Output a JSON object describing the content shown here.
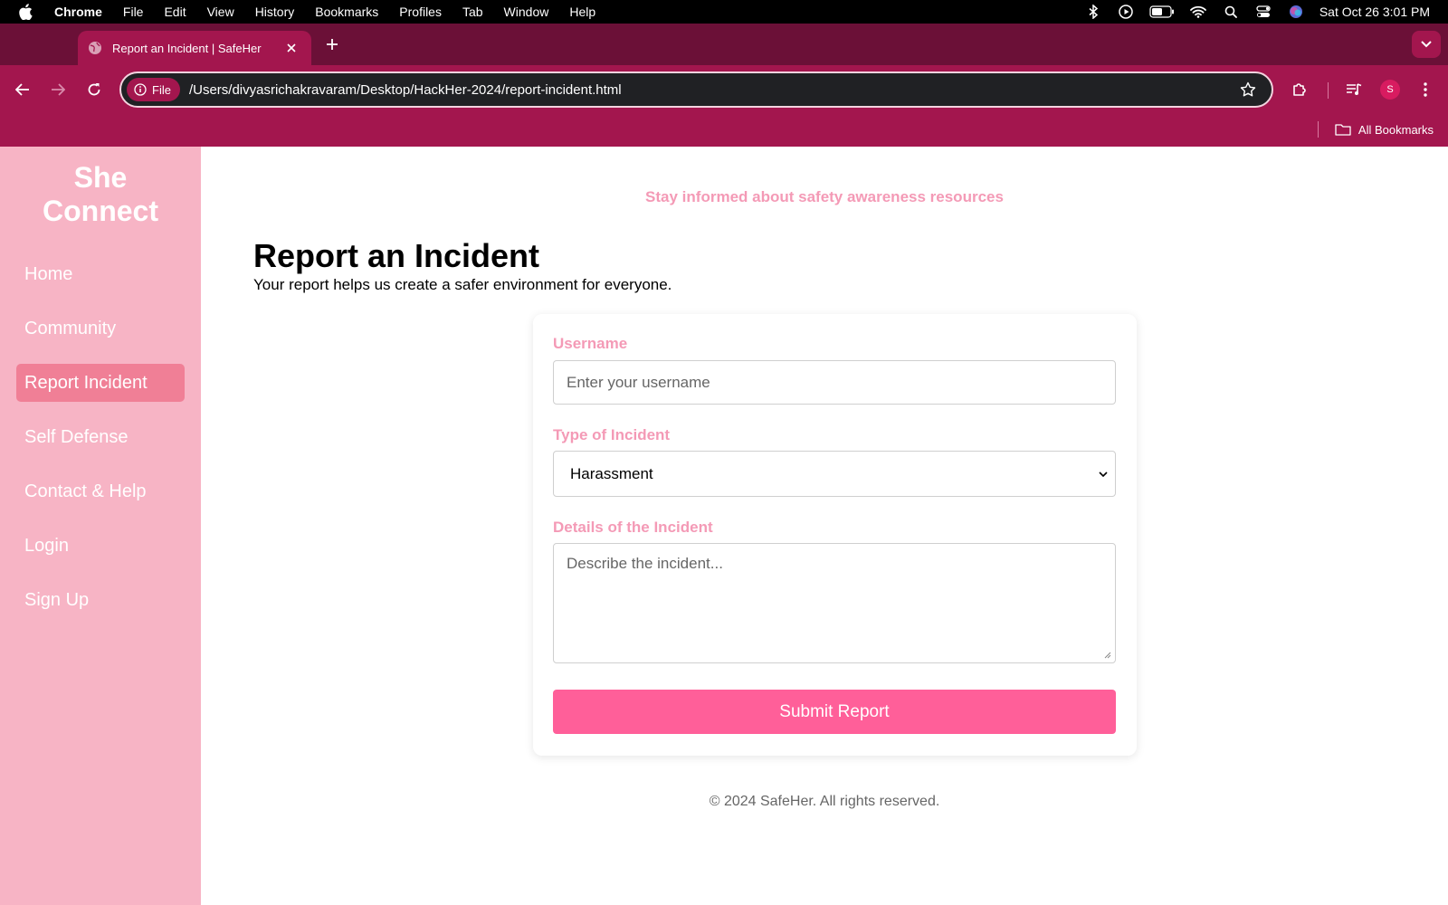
{
  "menubar": {
    "app_name": "Chrome",
    "items": [
      "File",
      "Edit",
      "View",
      "History",
      "Bookmarks",
      "Profiles",
      "Tab",
      "Window",
      "Help"
    ],
    "clock": "Sat Oct 26  3:01 PM",
    "status_icons": [
      "bluetooth-icon",
      "play-circle-icon",
      "battery-icon",
      "wifi-icon",
      "spotlight-search-icon",
      "control-center-icon",
      "siri-icon"
    ]
  },
  "browser": {
    "tab_title": "Report an Incident | SafeHer",
    "chip_label": "File",
    "url": "/Users/divyasrichakravaram/Desktop/HackHer-2024/report-incident.html",
    "profile_initial": "S",
    "bookmarks_label": "All Bookmarks",
    "colors": {
      "tabstrip": "#6b1037",
      "toolbar": "#a3164e"
    }
  },
  "sidebar": {
    "brand_line1": "She",
    "brand_line2": "Connect",
    "items": [
      {
        "label": "Home",
        "active": false
      },
      {
        "label": "Community",
        "active": false
      },
      {
        "label": "Report Incident",
        "active": true
      },
      {
        "label": "Self Defense",
        "active": false
      },
      {
        "label": "Contact & Help",
        "active": false
      },
      {
        "label": "Login",
        "active": false
      },
      {
        "label": "Sign Up",
        "active": false
      }
    ],
    "colors": {
      "background": "#f7b4c5",
      "active": "#f07f96"
    }
  },
  "main": {
    "banner": "Stay informed about safety awareness resources",
    "title": "Report an Incident",
    "subtitle": "Your report helps us create a safer environment for everyone.",
    "form": {
      "username_label": "Username",
      "username_placeholder": "Enter your username",
      "username_value": "",
      "type_label": "Type of Incident",
      "type_selected": "Harassment",
      "details_label": "Details of the Incident",
      "details_placeholder": "Describe the incident...",
      "details_value": "",
      "submit_label": "Submit Report"
    },
    "footer": "© 2024 SafeHer. All rights reserved.",
    "colors": {
      "accent": "#f49ab6",
      "button": "#ff5f99"
    }
  }
}
